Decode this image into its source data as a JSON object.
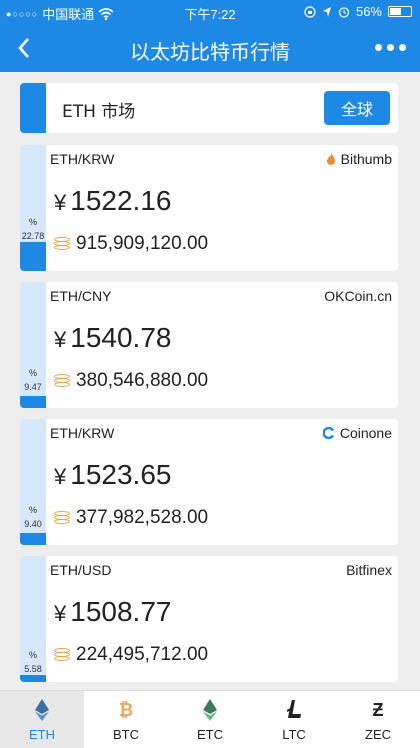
{
  "status_bar": {
    "signal": "●○○○○",
    "carrier": "中国联通",
    "wifi_icon": "wifi-icon",
    "time": "下午7:22",
    "battery": "56%",
    "battery_level": 0.56
  },
  "nav": {
    "back_icon": "‹",
    "title": "以太坊比特币行情",
    "more_icon": "more-icon"
  },
  "market": {
    "label": "ETH 市场",
    "global_button": "全球"
  },
  "cards": [
    {
      "pair": "ETH/KRW",
      "exchange": "Bithumb",
      "exchange_icon_color": "#f08b36",
      "price_symbol": "¥",
      "price": "1522.16",
      "volume": "915,909,120.00",
      "pct_symbol": "%",
      "pct": "22.78",
      "pct_fraction": 0.2278
    },
    {
      "pair": "ETH/CNY",
      "exchange": "OKCoin.cn",
      "exchange_icon_color": "",
      "price_symbol": "¥",
      "price": "1540.78",
      "volume": "380,546,880.00",
      "pct_symbol": "%",
      "pct": "9.47",
      "pct_fraction": 0.0947
    },
    {
      "pair": "ETH/KRW",
      "exchange": "Coinone",
      "exchange_icon_color": "#1e88e5",
      "price_symbol": "¥",
      "price": "1523.65",
      "volume": "377,982,528.00",
      "pct_symbol": "%",
      "pct": "9.40",
      "pct_fraction": 0.094
    },
    {
      "pair": "ETH/USD",
      "exchange": "Bitfinex",
      "exchange_icon_color": "",
      "price_symbol": "¥",
      "price": "1508.77",
      "volume": "224,495,712.00",
      "pct_symbol": "%",
      "pct": "5.58",
      "pct_fraction": 0.0558
    }
  ],
  "tabs": [
    {
      "label": "ETH",
      "icon": "eth-icon",
      "active": true,
      "color": "#3c6ea8"
    },
    {
      "label": "BTC",
      "icon": "btc-icon",
      "active": false,
      "color": "#e8a860"
    },
    {
      "label": "ETC",
      "icon": "etc-icon",
      "active": false,
      "color": "#3a7d5a"
    },
    {
      "label": "LTC",
      "icon": "ltc-icon",
      "active": false,
      "color": "#222222"
    },
    {
      "label": "ZEC",
      "icon": "zec-icon",
      "active": false,
      "color": "#222222"
    }
  ],
  "colors": {
    "primary": "#1e88e5",
    "side_bg": "#d6e9fc",
    "coin_icon": "#e0a64a"
  }
}
